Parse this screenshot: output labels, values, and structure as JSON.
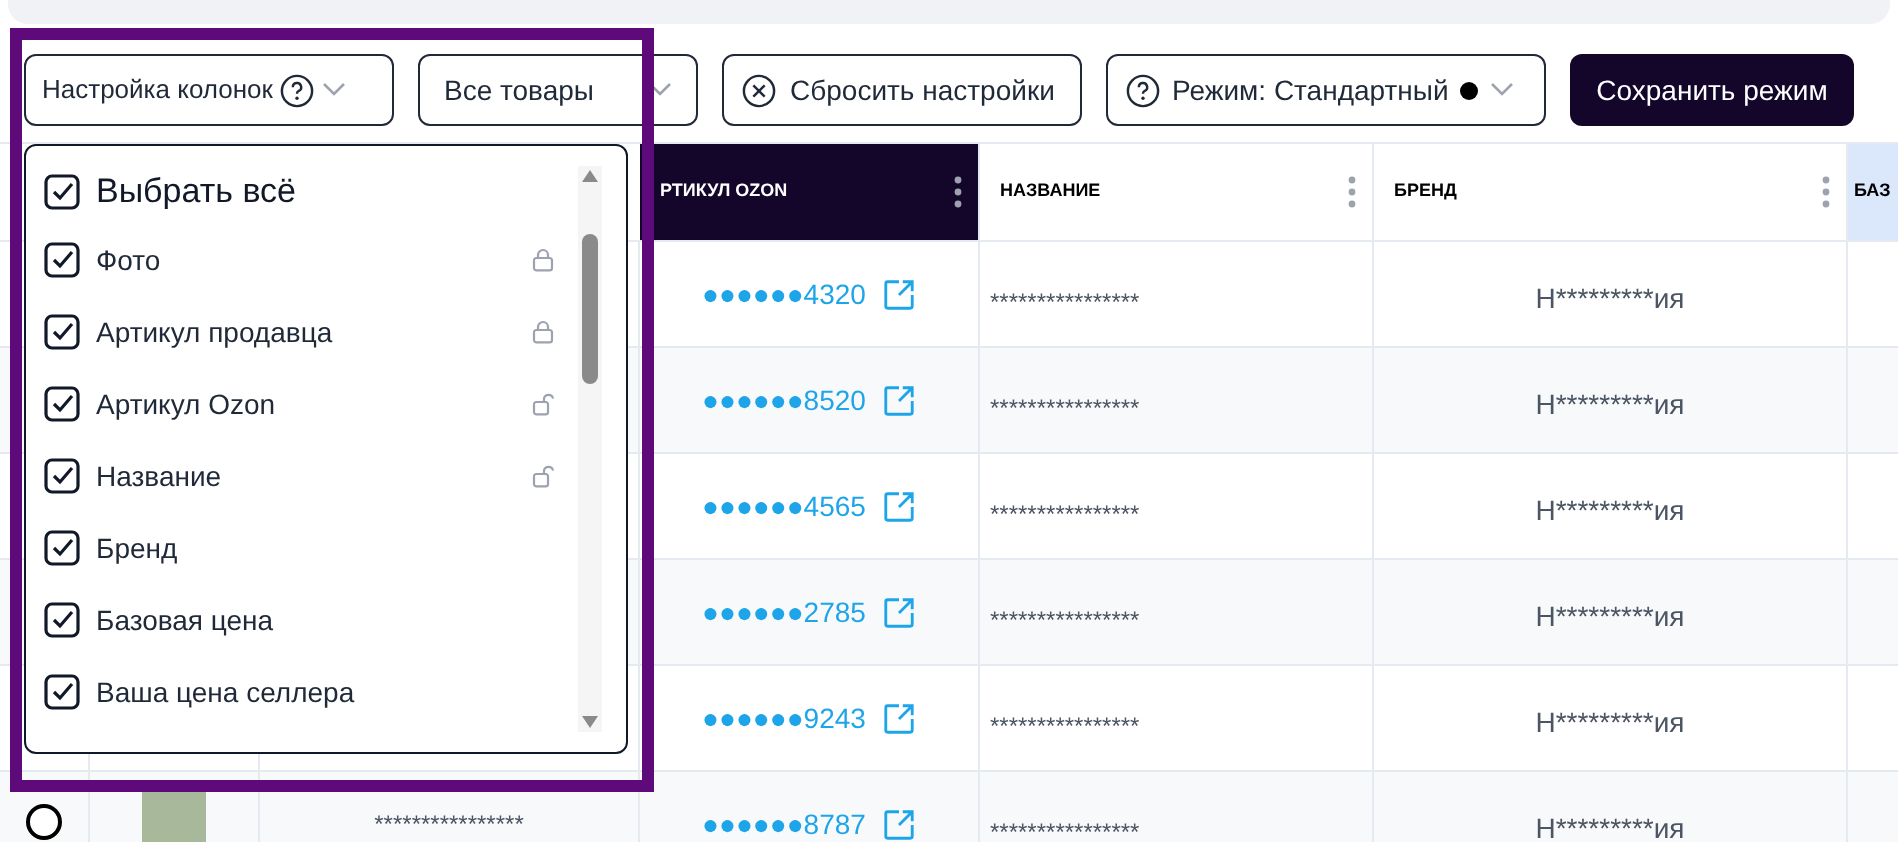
{
  "toolbar": {
    "column_settings": {
      "label": "Настройка колонок"
    },
    "filter": {
      "value": "Все товары"
    },
    "reset": {
      "label": "Сбросить настройки"
    },
    "mode": {
      "label": "Режим: Стандартный"
    },
    "save": {
      "label": "Сохранить режим"
    }
  },
  "column_menu": {
    "select_all": {
      "label": "Выбрать всё",
      "checked": true
    },
    "items": [
      {
        "label": "Фото",
        "checked": true,
        "locked": true
      },
      {
        "label": "Артикул продавца",
        "checked": true,
        "locked": true
      },
      {
        "label": "Артикул Ozon",
        "checked": true,
        "locked": false
      },
      {
        "label": "Название",
        "checked": true,
        "locked": false
      },
      {
        "label": "Бренд",
        "checked": true
      },
      {
        "label": "Базовая цена",
        "checked": true
      },
      {
        "label": "Ваша цена селлера",
        "checked": true
      }
    ]
  },
  "table": {
    "columns": [
      {
        "label": "РТИКУЛ OZON",
        "kind": "active"
      },
      {
        "label": "НАЗВАНИЕ",
        "kind": "plain"
      },
      {
        "label": "БРЕНД",
        "kind": "plain"
      },
      {
        "label": "БАЗ",
        "kind": "highlight"
      }
    ],
    "rows": [
      {
        "article_ozon": "●●●●●●4320",
        "name": "****************",
        "brand": "Н*********ия"
      },
      {
        "article_ozon": "●●●●●●8520",
        "name": "****************",
        "brand": "Н*********ия"
      },
      {
        "article_ozon": "●●●●●●4565",
        "name": "****************",
        "brand": "Н*********ия"
      },
      {
        "article_ozon": "●●●●●●2785",
        "name": "****************",
        "brand": "Н*********ия"
      },
      {
        "article_ozon": "●●●●●●9243",
        "name": "****************",
        "brand": "Н*********ия"
      },
      {
        "article_ozon": "●●●●●●8787",
        "name": "****************",
        "brand": "Н*********ия",
        "seller_article": "****************",
        "selected": false
      }
    ]
  }
}
